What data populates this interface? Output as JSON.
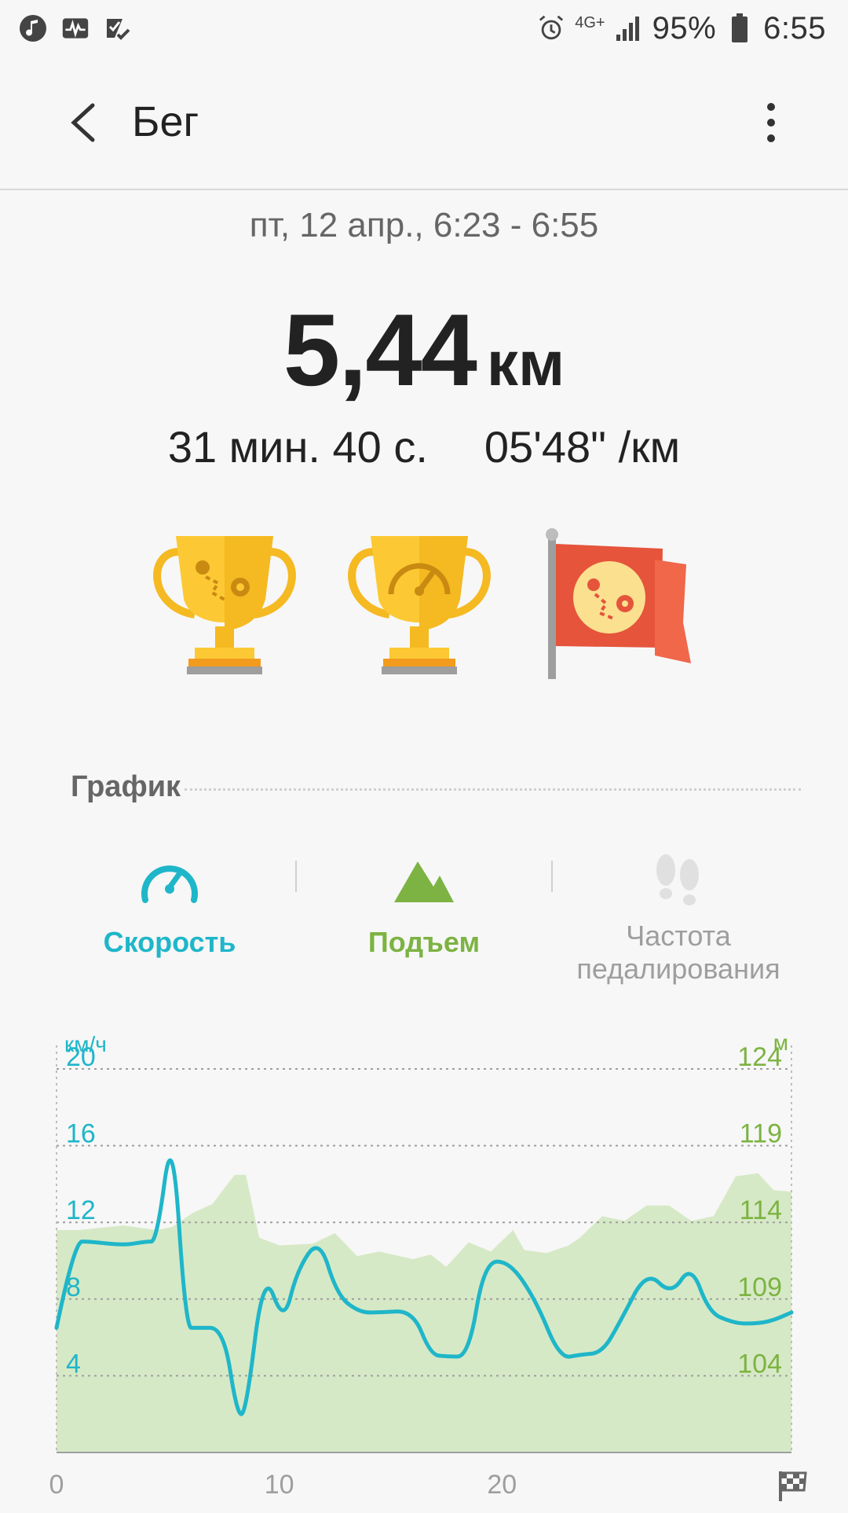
{
  "status_bar": {
    "battery": "95%",
    "time": "6:55",
    "network": "4G+"
  },
  "appbar": {
    "title": "Бег"
  },
  "workout": {
    "date": "пт, 12 апр., 6:23 - 6:55",
    "distance": "5,44",
    "distance_unit": "км",
    "duration": "31 мин. 40 с.",
    "pace": "05'48\" /км"
  },
  "graph": {
    "section_title": "График",
    "tabs": [
      {
        "label": "Скорость",
        "color": "#1fb6c9"
      },
      {
        "label": "Подъем",
        "color": "#7cb342"
      },
      {
        "label": "Частота\nпедалирования",
        "color": "#9e9e9e"
      }
    ]
  },
  "chart_data": {
    "type": "line",
    "xlabel": "",
    "x_ticks": [
      "0",
      "10",
      "20"
    ],
    "xlim": [
      0,
      33
    ],
    "left_axis": {
      "unit": "км/ч",
      "ticks": [
        "20",
        "16",
        "12",
        "8",
        "4"
      ],
      "ylim": [
        0,
        20
      ]
    },
    "right_axis": {
      "unit": "м",
      "ticks": [
        "124",
        "119",
        "114",
        "109",
        "104"
      ],
      "ylim": [
        99,
        124
      ]
    },
    "series": [
      {
        "type": "line",
        "color": "#1fb6c9",
        "axis": "left",
        "x": [
          0,
          0.8,
          1.5,
          3.0,
          4.0,
          4.5,
          5.2,
          5.8,
          6.3,
          7.5,
          8.1,
          8.5,
          9.3,
          10.2,
          10.8,
          11.8,
          12.6,
          13.6,
          14.5,
          16.0,
          16.8,
          17.5,
          18.5,
          19.2,
          20.3,
          21.5,
          22.6,
          23.5,
          24.5,
          25.3,
          26.5,
          27.6,
          28.5,
          29.3,
          30.3,
          31.0,
          32.0,
          33.0
        ],
        "y": [
          6.5,
          11.0,
          11.0,
          10.8,
          11.0,
          11.0,
          17.2,
          6.5,
          6.5,
          6.5,
          2.0,
          2.0,
          9.6,
          6.7,
          9.5,
          11.2,
          8.2,
          7.3,
          7.3,
          7.4,
          5.1,
          5.0,
          5.0,
          9.9,
          10.0,
          8.0,
          4.9,
          5.1,
          5.2,
          6.8,
          9.5,
          8.2,
          9.8,
          7.3,
          6.8,
          6.7,
          6.8,
          7.3
        ]
      },
      {
        "type": "area",
        "color": "#d6e9c6",
        "axis": "right",
        "x": [
          0,
          1,
          3,
          4.5,
          5.2,
          6.1,
          7.0,
          8.0,
          8.5,
          9.1,
          10.0,
          11.5,
          12.5,
          13.5,
          14.5,
          16.0,
          16.8,
          17.5,
          18.5,
          19.5,
          20.5,
          21.0,
          22.0,
          23.0,
          23.5,
          24.5,
          25.5,
          26.5,
          27.5,
          28.5,
          29.5,
          30.5,
          31.5,
          32.2,
          33.0
        ],
        "y": [
          113.5,
          113.5,
          113.8,
          113.5,
          113.7,
          114.6,
          115.2,
          117.1,
          117.1,
          113.0,
          112.5,
          112.6,
          113.3,
          111.8,
          112.1,
          111.6,
          111.9,
          111.1,
          112.7,
          112.1,
          113.5,
          112.2,
          112.0,
          112.5,
          113.0,
          114.4,
          114.1,
          115.1,
          115.1,
          114.1,
          114.4,
          117.0,
          117.2,
          116.1,
          116.0
        ]
      }
    ],
    "grid": true
  }
}
